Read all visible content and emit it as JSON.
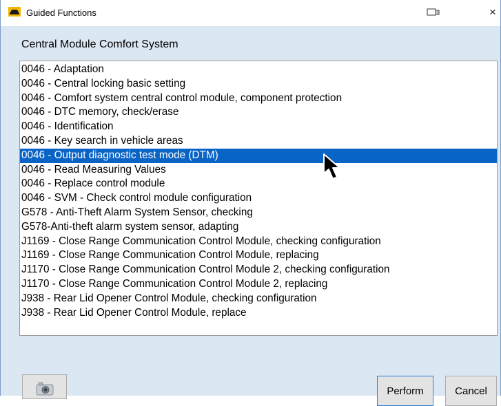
{
  "window": {
    "title": "Guided Functions",
    "close_glyph": "×"
  },
  "module": {
    "label": "Central Module Comfort System"
  },
  "functions": {
    "selected_index": 6,
    "items": [
      "0046 - Adaptation",
      "0046 - Central locking basic setting",
      "0046 - Comfort system central control module, component protection",
      "0046 - DTC memory, check/erase",
      "0046 - Identification",
      "0046 - Key search in vehicle areas",
      "0046 - Output diagnostic test mode (DTM)",
      "0046 - Read Measuring Values",
      "0046 - Replace control module",
      "0046 - SVM - Check control module configuration",
      "G578 - Anti-Theft Alarm System Sensor, checking",
      "G578-Anti-theft alarm system sensor, adapting",
      "J1169 - Close Range Communication Control Module, checking configuration",
      "J1169 - Close Range Communication Control Module, replacing",
      "J1170 - Close Range Communication Control Module 2, checking configuration",
      "J1170 - Close Range Communication Control Module 2, replacing",
      "J938 - Rear Lid Opener Control Module, checking configuration",
      "J938 - Rear Lid Opener Control Module, replace"
    ]
  },
  "buttons": {
    "perform_label": "Perform",
    "cancel_label": "Cancel",
    "camera_icon": "camera-icon"
  },
  "colors": {
    "selection": "#0a64c6",
    "window_bg": "#dbe7f3",
    "perform_border": "#2a7ad5"
  }
}
